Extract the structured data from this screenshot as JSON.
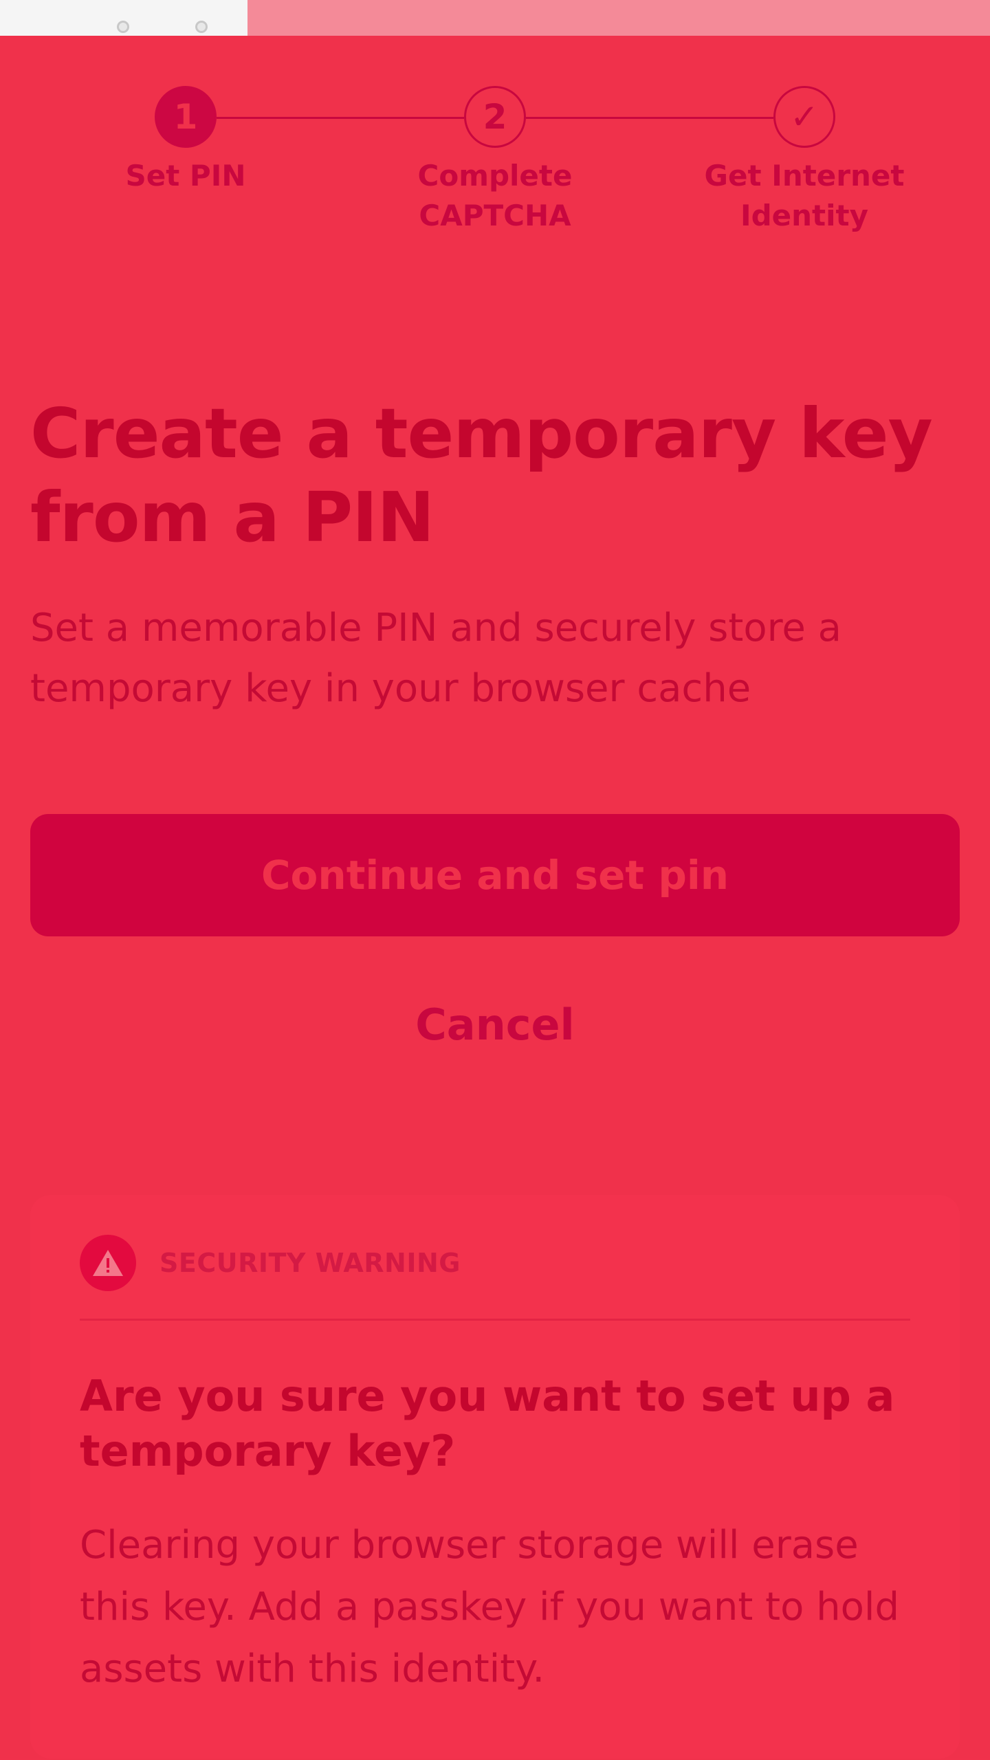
{
  "stepper": {
    "steps": [
      {
        "number": "1",
        "label": "Set PIN",
        "state": "active"
      },
      {
        "number": "2",
        "label": "Complete\nCAPTCHA",
        "state": "upcoming"
      },
      {
        "number": "✓",
        "label": "Get Internet\nIdentity",
        "state": "upcoming"
      }
    ]
  },
  "main": {
    "title": "Create a temporary key from a PIN",
    "subtitle": "Set a memorable PIN and securely store a temporary key in your browser cache",
    "primary_button": "Continue and set pin",
    "cancel_button": "Cancel"
  },
  "warning": {
    "label": "SECURITY WARNING",
    "icon": "warning-triangle-icon",
    "title": "Are you sure you want to set up a temporary key?",
    "body": "Clearing your browser storage will erase this key. Add a passkey if you want to hold assets with this identity."
  },
  "colors": {
    "background": "#f0314b",
    "accent": "#cc0743",
    "text": "#c4062e"
  }
}
